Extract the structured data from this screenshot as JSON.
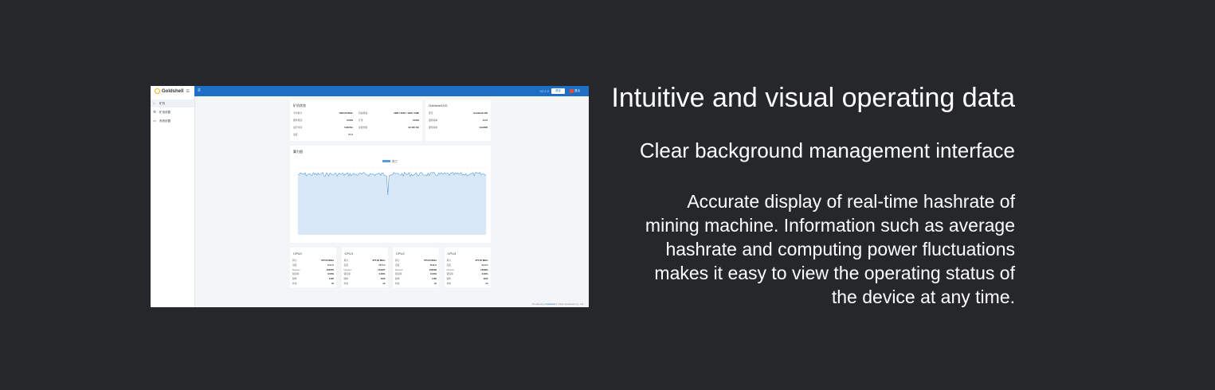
{
  "screenshot": {
    "logo_text": "Goldshell",
    "topbar": {
      "version": "V2.2.2",
      "lang_button": "语言",
      "logout_button": "退出"
    },
    "sidebar": {
      "items": [
        {
          "label": "矿机",
          "icon": "home-icon",
          "active": true
        },
        {
          "label": "矿池设置",
          "icon": "gear-icon",
          "active": false
        },
        {
          "label": "系统设置",
          "icon": "monitor-icon",
          "active": false
        }
      ]
    },
    "status_card": {
      "title": "矿机状态",
      "rows": [
        {
          "label": "平均算力",
          "value": "1500.00 MH/s"
        },
        {
          "label": "硬件错误",
          "value": "0.00%"
        },
        {
          "label": "运行时间",
          "value": "0d1h5m"
        },
        {
          "label": "温度",
          "value": "71 C"
        }
      ],
      "rows_right": [
        {
          "label": "风扇转速",
          "value": "1980 / 2040 / 1920 / 1980"
        },
        {
          "label": "矿池",
          "value": "0.00%"
        },
        {
          "label": "接受份额",
          "value": "3d 12h 0m"
        }
      ]
    },
    "info_card": {
      "title": "Goldshell-KD",
      "rows": [
        {
          "label": "型号",
          "value": "Goldshell-KD"
        },
        {
          "label": "固件版本",
          "value": "2.2.2"
        },
        {
          "label": "硬件版本",
          "value": "GoldKD"
        }
      ]
    },
    "hashrate_chart": {
      "title": "算力图",
      "legend": "算力"
    },
    "gpu_cards": [
      {
        "title": "CPU0",
        "rows": [
          [
            "算力",
            "375.00 MH/s"
          ],
          [
            "温度",
            "71.0 C"
          ],
          [
            "Nonces",
            "152279"
          ],
          [
            "错误率",
            "0.00%"
          ],
          [
            "频率",
            "1100"
          ],
          [
            "状态",
            "ok"
          ]
        ]
      },
      {
        "title": "CPU1",
        "rows": [
          [
            "算力",
            "375.00 MH/s"
          ],
          [
            "温度",
            "71.5 C"
          ],
          [
            "Nonces",
            "151977"
          ],
          [
            "错误率",
            "0.00%"
          ],
          [
            "频率",
            "1100"
          ],
          [
            "状态",
            "ok"
          ]
        ]
      },
      {
        "title": "CPU2",
        "rows": [
          [
            "算力",
            "375.00 MH/s"
          ],
          [
            "温度",
            "70.8 C"
          ],
          [
            "Nonces",
            "153038"
          ],
          [
            "错误率",
            "0.00%"
          ],
          [
            "频率",
            "1100"
          ],
          [
            "状态",
            "ok"
          ]
        ]
      },
      {
        "title": "CPU3",
        "rows": [
          [
            "算力",
            "375.00 MH/s"
          ],
          [
            "温度",
            "71.2 C"
          ],
          [
            "Nonces",
            "152954"
          ],
          [
            "错误率",
            "0.00%"
          ],
          [
            "频率",
            "1100"
          ],
          [
            "状态",
            "ok"
          ]
        ]
      }
    ],
    "footer": {
      "prefix": "Provided by ",
      "link": "Goldshell",
      "suffix": " © 2021 Goldshell Co., Ltd."
    }
  },
  "heading": "Intuitive and visual operating data",
  "subheading": "Clear background management interface",
  "description": "Accurate display of real-time hashrate of mining machine. Information such as average hashrate and computing power fluctuations makes it easy to view the operating status of the device at any time.",
  "colors": {
    "background": "#25272b",
    "topbar": "#1f6ec5",
    "chart_line": "#5a9bd8",
    "chart_fill": "#d9e8f7"
  }
}
